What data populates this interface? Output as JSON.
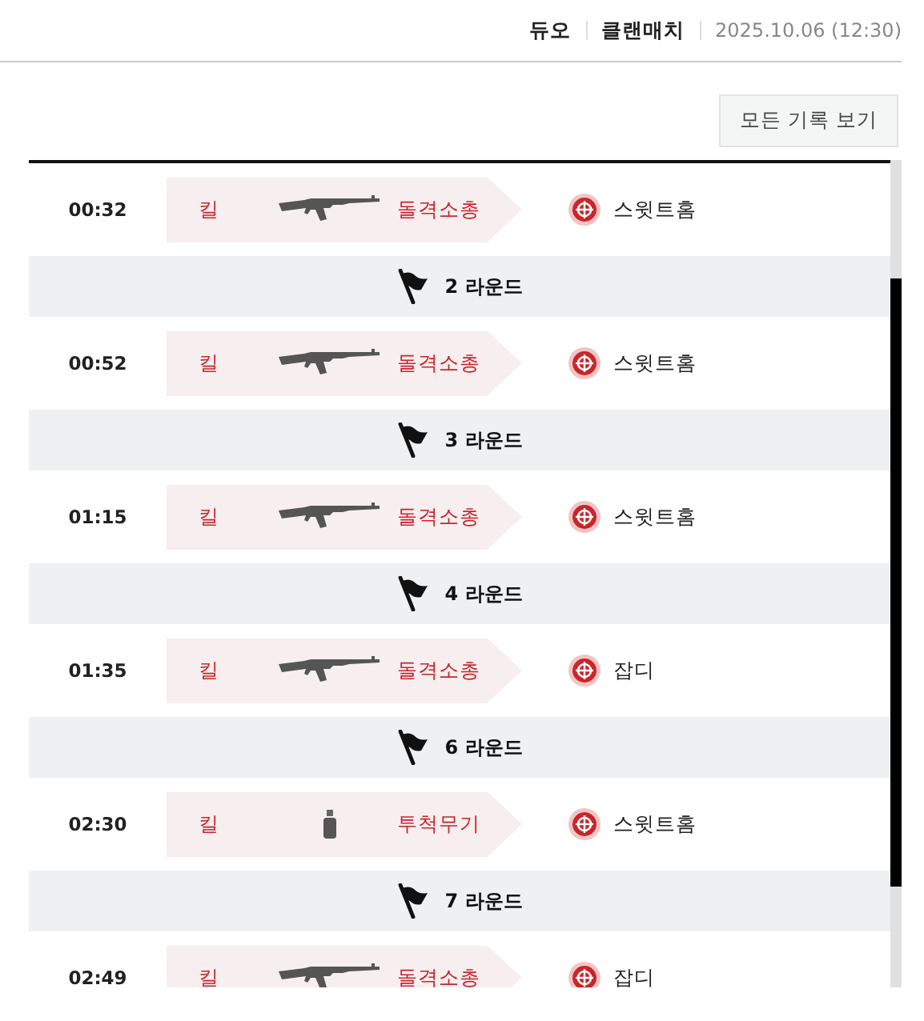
{
  "header": {
    "mode": "듀오",
    "match_type": "클랜매치",
    "datetime": "2025.10.06 (12:30)"
  },
  "view_all_button": "모든 기록 보기",
  "events": [
    {
      "kind": "kill",
      "time": "00:32",
      "action": "킬",
      "weapon_icon": {
        "kind": "rifle"
      },
      "weapon": "돌격소총",
      "target": "스윗트홈"
    },
    {
      "kind": "round",
      "label": "2 라운드"
    },
    {
      "kind": "kill",
      "time": "00:52",
      "action": "킬",
      "weapon_icon": {
        "kind": "rifle"
      },
      "weapon": "돌격소총",
      "target": "스윗트홈"
    },
    {
      "kind": "round",
      "label": "3 라운드"
    },
    {
      "kind": "kill",
      "time": "01:15",
      "action": "킬",
      "weapon_icon": {
        "kind": "rifle"
      },
      "weapon": "돌격소총",
      "target": "스윗트홈"
    },
    {
      "kind": "round",
      "label": "4 라운드"
    },
    {
      "kind": "kill",
      "time": "01:35",
      "action": "킬",
      "weapon_icon": {
        "kind": "rifle"
      },
      "weapon": "돌격소총",
      "target": "잡디"
    },
    {
      "kind": "round",
      "label": "6 라운드"
    },
    {
      "kind": "kill",
      "time": "02:30",
      "action": "킬",
      "weapon_icon": {
        "kind": "grenade"
      },
      "weapon": "투척무기",
      "target": "스윗트홈"
    },
    {
      "kind": "round",
      "label": "7 라운드"
    },
    {
      "kind": "kill",
      "time": "02:49",
      "action": "킬",
      "weapon_icon": {
        "kind": "rifle"
      },
      "weapon": "돌격소총",
      "target": "잡디"
    }
  ]
}
